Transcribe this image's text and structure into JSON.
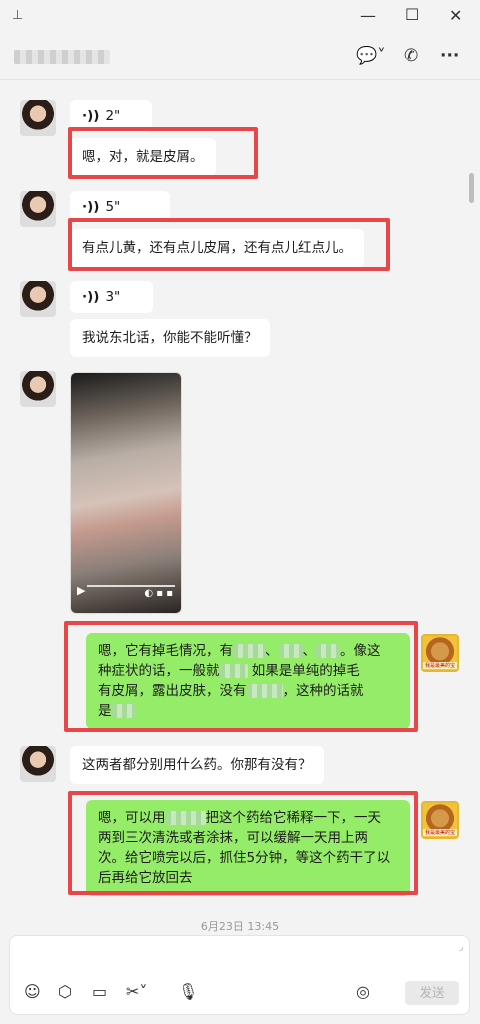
{
  "window": {
    "pin": "⊥",
    "minimize": "—",
    "maximize": "☐",
    "close": "✕"
  },
  "header": {
    "chat_icon": "💬˅",
    "call_icon": "✆",
    "more_icon": "···"
  },
  "messages": [
    {
      "type": "voice",
      "duration": "2\""
    },
    {
      "type": "text",
      "text": "嗯，对，就是皮屑。"
    },
    {
      "type": "voice",
      "duration": "5\""
    },
    {
      "type": "text",
      "text": "有点儿黄，还有点儿皮屑，还有点儿红点儿。"
    },
    {
      "type": "voice",
      "duration": "3\""
    },
    {
      "type": "text",
      "text": "我说东北话，你能不能听懂？"
    },
    {
      "type": "video"
    },
    {
      "type": "text_sent",
      "line1": "嗯，它有掉毛情况，有",
      "line1b": "、",
      "line1c": "、",
      "line1d": "。像这",
      "line2a": "种症状的话，一般就",
      "line2b": "如果是单纯的掉毛",
      "line3a": "有皮屑，露出皮肤，没有",
      "line3b": "，这种的话就",
      "line4a": "是"
    },
    {
      "type": "text",
      "text": "这两者都分别用什么药。你那有没有？"
    },
    {
      "type": "text_sent",
      "line1a": "嗯，可以用",
      "line1b": "把这个药给它稀释一下，一天",
      "line2": "两到三次清洗或者涂抹，可以缓解一天用上两",
      "line3": "次。给它喷完以后，抓住5分钟，等这个药干了以",
      "line4": "后再给它放回去"
    }
  ],
  "voice_wave": "·))",
  "dog_avatar_text": "我是最美的宝",
  "timestamp": "6月23日 13:45",
  "toolbar": {
    "emoji": "☺",
    "box": "⬡",
    "folder": "▭",
    "scissors": "✂˅",
    "mic": "🎙",
    "voice_call": "◎",
    "send_label": "发送"
  },
  "colors": {
    "highlight": "#e8474a",
    "sent_bubble": "#95ec69",
    "recv_bubble": "#ffffff"
  }
}
